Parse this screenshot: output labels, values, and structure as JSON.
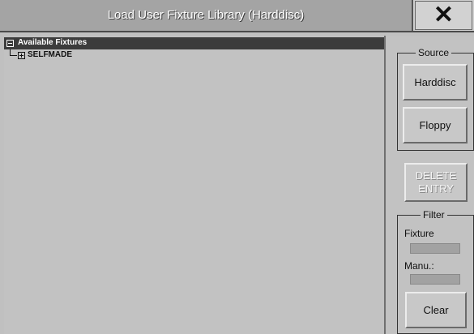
{
  "window": {
    "title": "Load User Fixture Library (Harddisc)",
    "close_icon": "close-icon",
    "close_glyph": "✕"
  },
  "tree": {
    "root_label": "Available Fixtures",
    "root_state": "expanded",
    "children": [
      {
        "label": "SELFMADE",
        "state": "collapsed"
      }
    ]
  },
  "source": {
    "title": "Source",
    "harddisc_label": "Harddisc",
    "floppy_label": "Floppy"
  },
  "delete": {
    "line1": "DELETE",
    "line2": "ENTRY",
    "enabled": false
  },
  "filter": {
    "title": "Filter",
    "fixture_label": "Fixture",
    "fixture_value": "",
    "manu_label": "Manu.:",
    "manu_value": "",
    "clear_label": "Clear"
  }
}
